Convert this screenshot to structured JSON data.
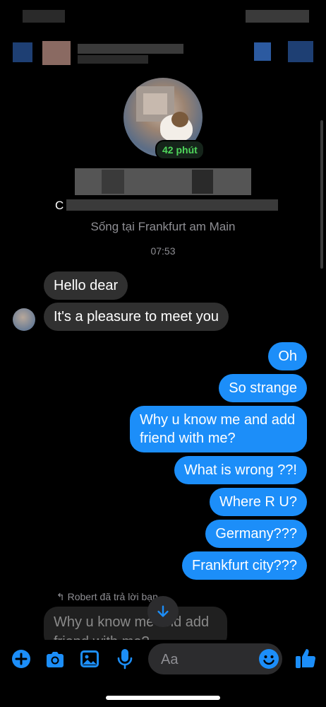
{
  "profile": {
    "active_badge": "42 phút",
    "name_prefix": "C",
    "location": "Sống tại Frankfurt am Main"
  },
  "chat": {
    "timestamp": "07:53",
    "incoming": [
      "Hello dear",
      "It's a pleasure to meet you"
    ],
    "outgoing": [
      "Oh",
      "So strange",
      "Why u know me and add friend with me?",
      "What is wrong ??!",
      "Where R U?",
      "Germany???",
      "Frankfurt city???"
    ],
    "reply_label": "Robert đã trả lời bạn",
    "reply_preview": "Why u know me and add friend with me?"
  },
  "composer": {
    "placeholder": "Aa"
  },
  "icons": {
    "add": "plus-circle-icon",
    "camera": "camera-icon",
    "gallery": "image-icon",
    "voice": "microphone-icon",
    "emoji": "emoji-icon",
    "like": "thumbs-up-icon",
    "scroll": "arrow-down-icon"
  },
  "colors": {
    "outgoing_bubble": "#1c8ef9",
    "incoming_bubble": "#303030",
    "accent": "#1c8ef9",
    "active_green": "#4fd65b"
  }
}
